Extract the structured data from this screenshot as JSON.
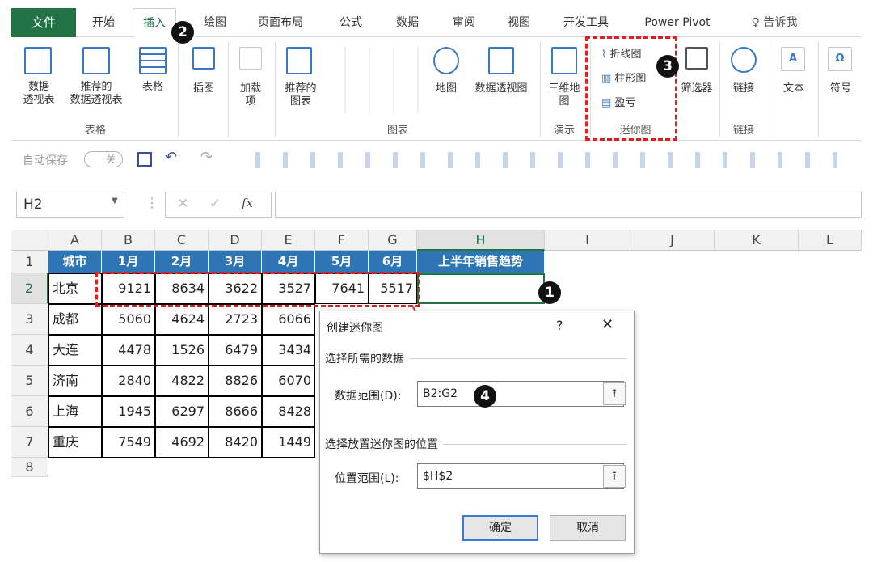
{
  "tabs": [
    "文件",
    "开始",
    "插入",
    "绘图",
    "页面布局",
    "公式",
    "数据",
    "审阅",
    "视图",
    "开发工具",
    "Power Pivot",
    "告诉我"
  ],
  "ribbon": {
    "pivot_table": "数据\n透视表",
    "rec_pivot": "推荐的\n数据透视表",
    "table": "表格",
    "group_table": "表格",
    "illustrations": "插图",
    "addins": "加载\n项",
    "rec_charts": "推荐的\n图表",
    "maps": "地图",
    "pivot_chart": "数据透视图",
    "group_charts": "图表",
    "map3d": "三维地\n图",
    "group_tours": "演示",
    "spark_line": "折线图",
    "spark_column": "柱形图",
    "spark_winloss": "盈亏",
    "group_sparklines": "迷你图",
    "slicer": "筛选器",
    "link": "链接",
    "group_links": "链接",
    "text": "文本",
    "symbols": "符号"
  },
  "quick_access": {
    "autosave": "自动保存",
    "toggle": "关"
  },
  "name_box": "H2",
  "fx": "fx",
  "columns": [
    "A",
    "B",
    "C",
    "D",
    "E",
    "F",
    "G",
    "H",
    "I",
    "J",
    "K",
    "L"
  ],
  "rows": [
    "1",
    "2",
    "3",
    "4",
    "5",
    "6",
    "7",
    "8"
  ],
  "table_header": [
    "城市",
    "1月",
    "2月",
    "3月",
    "4月",
    "5月",
    "6月",
    "上半年销售趋势"
  ],
  "table_rows": [
    [
      "北京",
      "9121",
      "8634",
      "3622",
      "3527",
      "7641",
      "5517"
    ],
    [
      "成都",
      "5060",
      "4624",
      "2723",
      "6066"
    ],
    [
      "大连",
      "4478",
      "1526",
      "6479",
      "3434"
    ],
    [
      "济南",
      "2840",
      "4822",
      "8826",
      "6070"
    ],
    [
      "上海",
      "1945",
      "6297",
      "8666",
      "8428"
    ],
    [
      "重庆",
      "7549",
      "4692",
      "8420",
      "1449"
    ]
  ],
  "dialog": {
    "title": "创建迷你图",
    "help": "?",
    "close": "✕",
    "sec1": "选择所需的数据",
    "data_range_label": "数据范围(D):",
    "data_range_value": "B2:G2",
    "sec2": "选择放置迷你图的位置",
    "loc_range_label": "位置范围(L):",
    "loc_range_value": "$H$2",
    "ok": "确定",
    "cancel": "取消"
  },
  "badges": [
    "1",
    "2",
    "3",
    "4"
  ]
}
